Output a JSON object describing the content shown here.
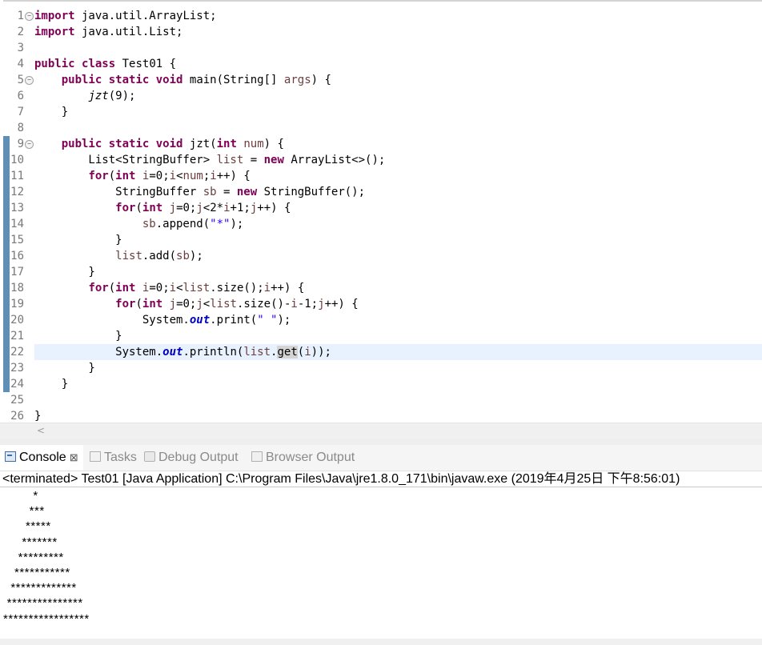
{
  "editor": {
    "lines": [
      {
        "n": "1",
        "fold": true
      },
      {
        "n": "2"
      },
      {
        "n": "3"
      },
      {
        "n": "4"
      },
      {
        "n": "5",
        "fold": true
      },
      {
        "n": "6"
      },
      {
        "n": "7"
      },
      {
        "n": "8"
      },
      {
        "n": "9",
        "fold": true
      },
      {
        "n": "10"
      },
      {
        "n": "11"
      },
      {
        "n": "12"
      },
      {
        "n": "13"
      },
      {
        "n": "14"
      },
      {
        "n": "15"
      },
      {
        "n": "16"
      },
      {
        "n": "17"
      },
      {
        "n": "18"
      },
      {
        "n": "19"
      },
      {
        "n": "20"
      },
      {
        "n": "21"
      },
      {
        "n": "22",
        "current": true
      },
      {
        "n": "23"
      },
      {
        "n": "24"
      },
      {
        "n": "25"
      },
      {
        "n": "26"
      }
    ],
    "code": [
      [
        {
          "t": "import",
          "c": "kw"
        },
        {
          "t": " java.util.ArrayList;"
        }
      ],
      [
        {
          "t": "import",
          "c": "kw"
        },
        {
          "t": " java.util.List;"
        }
      ],
      [],
      [
        {
          "t": "public",
          "c": "kw"
        },
        {
          "t": " "
        },
        {
          "t": "class",
          "c": "kw"
        },
        {
          "t": " Test01 {"
        }
      ],
      [
        {
          "t": "    "
        },
        {
          "t": "public",
          "c": "kw"
        },
        {
          "t": " "
        },
        {
          "t": "static",
          "c": "kw"
        },
        {
          "t": " "
        },
        {
          "t": "void",
          "c": "kw"
        },
        {
          "t": " main(String[] "
        },
        {
          "t": "args",
          "c": "var"
        },
        {
          "t": ") {"
        }
      ],
      [
        {
          "t": "        "
        },
        {
          "t": "jzt",
          "c": "ital"
        },
        {
          "t": "(9);"
        }
      ],
      [
        {
          "t": "    }"
        }
      ],
      [],
      [
        {
          "t": "    "
        },
        {
          "t": "public",
          "c": "kw"
        },
        {
          "t": " "
        },
        {
          "t": "static",
          "c": "kw"
        },
        {
          "t": " "
        },
        {
          "t": "void",
          "c": "kw"
        },
        {
          "t": " jzt("
        },
        {
          "t": "int",
          "c": "kw"
        },
        {
          "t": " "
        },
        {
          "t": "num",
          "c": "var"
        },
        {
          "t": ") {"
        }
      ],
      [
        {
          "t": "        List<StringBuffer> "
        },
        {
          "t": "list",
          "c": "var"
        },
        {
          "t": " = "
        },
        {
          "t": "new",
          "c": "kw"
        },
        {
          "t": " ArrayList<>();"
        }
      ],
      [
        {
          "t": "        "
        },
        {
          "t": "for",
          "c": "kw"
        },
        {
          "t": "("
        },
        {
          "t": "int",
          "c": "kw"
        },
        {
          "t": " "
        },
        {
          "t": "i",
          "c": "var"
        },
        {
          "t": "=0;"
        },
        {
          "t": "i",
          "c": "var"
        },
        {
          "t": "<"
        },
        {
          "t": "num",
          "c": "var"
        },
        {
          "t": ";"
        },
        {
          "t": "i",
          "c": "var"
        },
        {
          "t": "++) {"
        }
      ],
      [
        {
          "t": "            StringBuffer "
        },
        {
          "t": "sb",
          "c": "var"
        },
        {
          "t": " = "
        },
        {
          "t": "new",
          "c": "kw"
        },
        {
          "t": " StringBuffer();"
        }
      ],
      [
        {
          "t": "            "
        },
        {
          "t": "for",
          "c": "kw"
        },
        {
          "t": "("
        },
        {
          "t": "int",
          "c": "kw"
        },
        {
          "t": " "
        },
        {
          "t": "j",
          "c": "var"
        },
        {
          "t": "=0;"
        },
        {
          "t": "j",
          "c": "var"
        },
        {
          "t": "<2*"
        },
        {
          "t": "i",
          "c": "var"
        },
        {
          "t": "+1;"
        },
        {
          "t": "j",
          "c": "var"
        },
        {
          "t": "++) {"
        }
      ],
      [
        {
          "t": "                "
        },
        {
          "t": "sb",
          "c": "var"
        },
        {
          "t": ".append("
        },
        {
          "t": "\"*\"",
          "c": "str"
        },
        {
          "t": ");"
        }
      ],
      [
        {
          "t": "            }"
        }
      ],
      [
        {
          "t": "            "
        },
        {
          "t": "list",
          "c": "var"
        },
        {
          "t": ".add("
        },
        {
          "t": "sb",
          "c": "var"
        },
        {
          "t": ");"
        }
      ],
      [
        {
          "t": "        }"
        }
      ],
      [
        {
          "t": "        "
        },
        {
          "t": "for",
          "c": "kw"
        },
        {
          "t": "("
        },
        {
          "t": "int",
          "c": "kw"
        },
        {
          "t": " "
        },
        {
          "t": "i",
          "c": "var"
        },
        {
          "t": "=0;"
        },
        {
          "t": "i",
          "c": "var"
        },
        {
          "t": "<"
        },
        {
          "t": "list",
          "c": "var"
        },
        {
          "t": ".size();"
        },
        {
          "t": "i",
          "c": "var"
        },
        {
          "t": "++) {"
        }
      ],
      [
        {
          "t": "            "
        },
        {
          "t": "for",
          "c": "kw"
        },
        {
          "t": "("
        },
        {
          "t": "int",
          "c": "kw"
        },
        {
          "t": " "
        },
        {
          "t": "j",
          "c": "var"
        },
        {
          "t": "=0;"
        },
        {
          "t": "j",
          "c": "var"
        },
        {
          "t": "<"
        },
        {
          "t": "list",
          "c": "var"
        },
        {
          "t": ".size()-"
        },
        {
          "t": "i",
          "c": "var"
        },
        {
          "t": "-1;"
        },
        {
          "t": "j",
          "c": "var"
        },
        {
          "t": "++) {"
        }
      ],
      [
        {
          "t": "                System."
        },
        {
          "t": "out",
          "c": "field"
        },
        {
          "t": ".print("
        },
        {
          "t": "\" \"",
          "c": "str"
        },
        {
          "t": ");"
        }
      ],
      [
        {
          "t": "            }"
        }
      ],
      [
        {
          "t": "            System."
        },
        {
          "t": "out",
          "c": "field"
        },
        {
          "t": ".println("
        },
        {
          "t": "list",
          "c": "var"
        },
        {
          "t": "."
        },
        {
          "t": "get",
          "c": "occ"
        },
        {
          "t": "("
        },
        {
          "t": "i",
          "c": "var"
        },
        {
          "t": "));"
        }
      ],
      [
        {
          "t": "        }"
        }
      ],
      [
        {
          "t": "    }"
        }
      ],
      [],
      [
        {
          "t": "}"
        }
      ]
    ]
  },
  "console": {
    "tabs": [
      {
        "label": "Console",
        "active": true,
        "icon": "console-icon"
      },
      {
        "label": "Tasks",
        "active": false,
        "icon": "tasks-icon"
      },
      {
        "label": "Debug Output",
        "active": false,
        "icon": "debug-output-icon"
      },
      {
        "label": "Browser Output",
        "active": false,
        "icon": "browser-output-icon"
      }
    ],
    "close_glyph": "⊠",
    "status": "<terminated> Test01 [Java Application] C:\\Program Files\\Java\\jre1.8.0_171\\bin\\javaw.exe (2019年4月25日 下午8:56:01)",
    "output": [
      "        *",
      "       ***",
      "      *****",
      "     *******",
      "    *********",
      "   ***********",
      "  *************",
      " ***************",
      "*****************"
    ]
  },
  "scroll": {
    "left_arrow": "<"
  }
}
